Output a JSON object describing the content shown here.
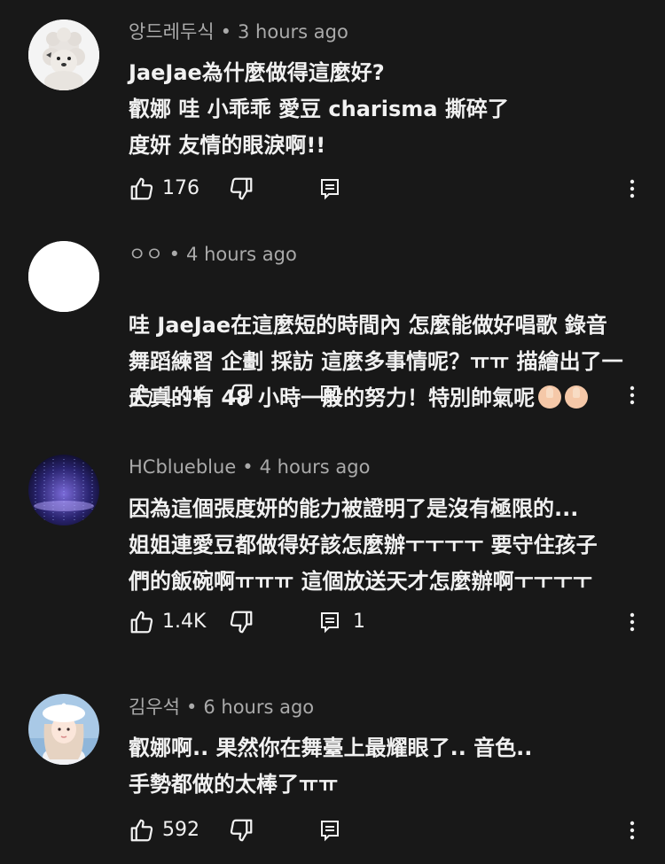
{
  "comments": [
    {
      "author": "앙드레두식",
      "time": "3 hours ago",
      "text": "JaeJae為什麼做得這麼好?\n叡娜 哇 小乖乖 愛豆 charisma 撕碎了\n度妍 友情的眼淚啊!!",
      "likes": "176",
      "replies": "",
      "avatar": "poodle-avatar"
    },
    {
      "author": "ㅇㅇ",
      "time": "4 hours ago",
      "text": "哇 JaeJae在這麼短的時間內 怎麼能做好唱歌 錄音\n舞蹈練習 企劃 採訪 這麼多事情呢？ㅠㅠ 描繪出了一\n天真的有 48 小時一般的努力！特別帥氣呢",
      "likes": "1.1K",
      "replies": "",
      "avatar": "white-avatar"
    },
    {
      "author": "HCblueblue",
      "time": "4 hours ago",
      "text": "因為這個張度妍的能力被證明了是沒有極限的...\n姐姐連愛豆都做得好該怎麼辦ㅜㅜㅜㅜ 要守住孩子\n們的飯碗啊ㅠㅠㅠ 這個放送天才怎麼辦啊ㅜㅜㅜㅜ",
      "likes": "1.4K",
      "replies": "1",
      "avatar": "blue-lights-avatar"
    },
    {
      "author": "김우석",
      "time": "6 hours ago",
      "text": "叡娜啊.. 果然你在舞臺上最耀眼了.. 音色..\n手勢都做的太棒了ㅠㅠ",
      "likes": "592",
      "replies": "",
      "avatar": "girl-beret-avatar"
    }
  ],
  "colors": {
    "background": "#181818",
    "text": "#f1f1f1",
    "meta": "#aaaaaa"
  }
}
